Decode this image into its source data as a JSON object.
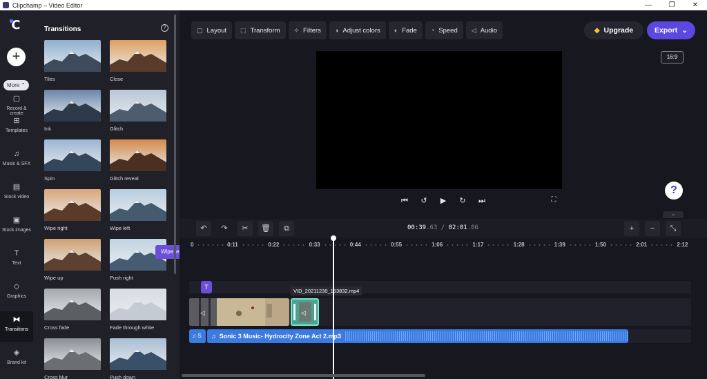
{
  "window": {
    "title": "Clipchamp – Video Editor",
    "minimize": "—",
    "maximize": "❐",
    "close": "✕"
  },
  "rail": {
    "logo": "C",
    "add": "+",
    "more": "More",
    "items": [
      {
        "label": "Record & create",
        "icon": "record-icon",
        "glyph": "▢"
      },
      {
        "label": "Templates",
        "icon": "templates-icon",
        "glyph": "⊞"
      },
      {
        "label": "Music & SFX",
        "icon": "music-icon",
        "glyph": "♫"
      },
      {
        "label": "Stock video",
        "icon": "stock-video-icon",
        "glyph": "▤"
      },
      {
        "label": "Stock images",
        "icon": "stock-images-icon",
        "glyph": "▣"
      },
      {
        "label": "Text",
        "icon": "text-icon",
        "glyph": "T"
      },
      {
        "label": "Graphics",
        "icon": "graphics-icon",
        "glyph": "◇"
      },
      {
        "label": "Transitions",
        "icon": "transitions-icon",
        "glyph": "⧓"
      },
      {
        "label": "Brand kit",
        "icon": "brand-kit-icon",
        "glyph": "◈"
      }
    ]
  },
  "panel": {
    "title": "Transitions",
    "tiles": [
      {
        "label": "Tiles"
      },
      {
        "label": "Close"
      },
      {
        "label": "Ink"
      },
      {
        "label": "Glitch"
      },
      {
        "label": "Spin"
      },
      {
        "label": "Glitch reveal"
      },
      {
        "label": "Wipe right"
      },
      {
        "label": "Wipe left"
      },
      {
        "label": "Wipe up"
      },
      {
        "label": "Push right"
      },
      {
        "label": "Cross fade"
      },
      {
        "label": "Fade through white"
      },
      {
        "label": "Cross blur"
      },
      {
        "label": "Push down"
      }
    ],
    "tooltip": "Wipe left"
  },
  "toolbar": {
    "buttons": [
      {
        "label": "Layout",
        "glyph": "▢"
      },
      {
        "label": "Transform",
        "glyph": "⬚"
      },
      {
        "label": "Filters",
        "glyph": "✧"
      },
      {
        "label": "Adjust colors",
        "glyph": "◑"
      },
      {
        "label": "Fade",
        "glyph": "◐"
      },
      {
        "label": "Speed",
        "glyph": "◔"
      },
      {
        "label": "Audio",
        "glyph": "◁"
      }
    ],
    "upgrade": "Upgrade",
    "export": "Export"
  },
  "preview": {
    "aspect_ratio": "16:9",
    "help": "?"
  },
  "timeline": {
    "time_current_main": "00:39",
    "time_current_frac": ".63",
    "time_sep": " / ",
    "time_total_main": "02:01",
    "time_total_frac": ".06",
    "ruler": [
      "0",
      "0:11",
      "0:22",
      "0:33",
      "0:44",
      "0:55",
      "1:06",
      "1:17",
      "1:28",
      "1:39",
      "1:50",
      "2:01",
      "2:12"
    ],
    "clip_tooltip": "VID_20211230_153832.mp4",
    "title_chip": "T",
    "audio_short_label": "S",
    "audio_label": "Sonic 3 Music- Hydrocity Zone Act 2.mp3"
  }
}
